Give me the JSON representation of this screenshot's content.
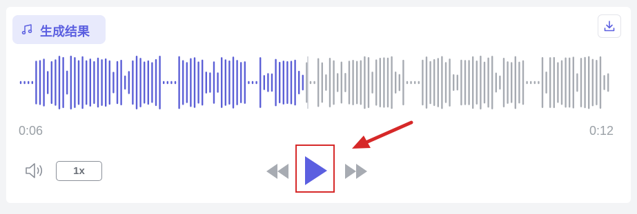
{
  "header": {
    "title": "生成结果",
    "title_icon": "music-note-icon",
    "download_icon": "download-icon"
  },
  "player": {
    "current_time": "0:06",
    "duration": "0:12",
    "progress": 0.5,
    "speed_label": "1x",
    "icons": {
      "volume": "volume-icon",
      "rewind": "rewind-icon",
      "play": "play-icon",
      "forward": "fast-forward-icon"
    }
  },
  "annotation": {
    "type": "red-arrow-highlight",
    "target": "play-button"
  },
  "colors": {
    "accent": "#5b5fe0",
    "played_wave": "#5b5fd6",
    "unplayed_wave": "#a7abb2",
    "badge_bg": "#e8eafc",
    "highlight": "#d62828"
  }
}
